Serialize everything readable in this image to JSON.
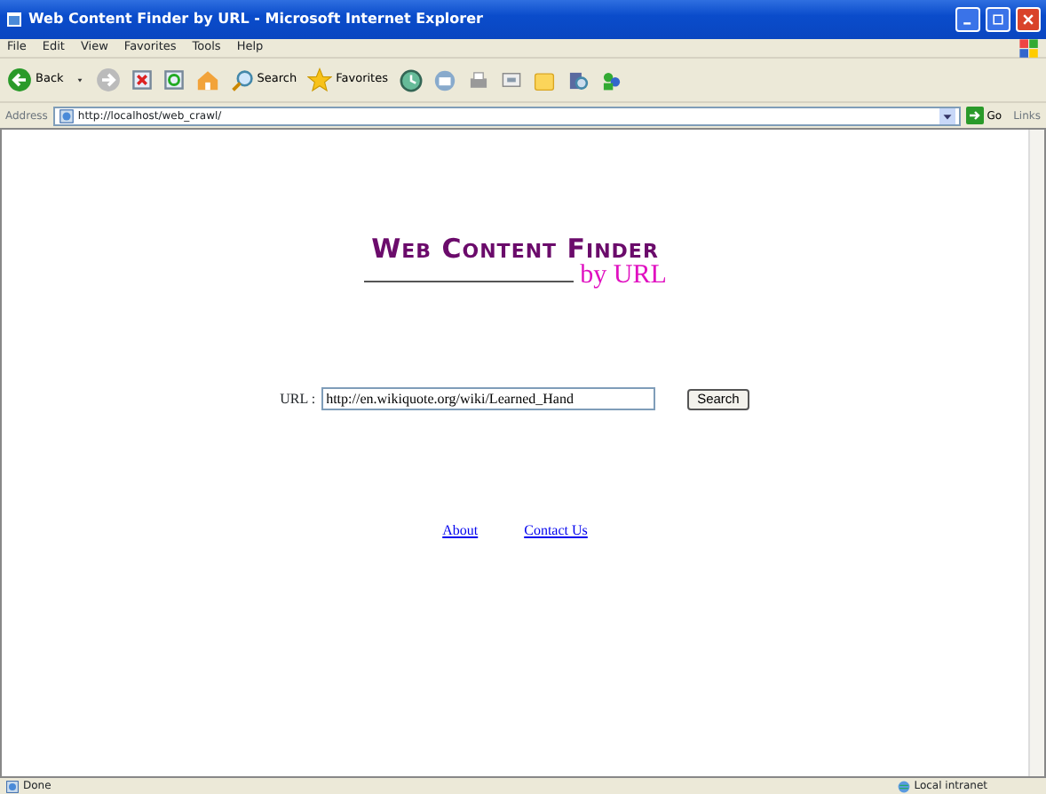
{
  "window": {
    "title": "Web Content Finder by URL - Microsoft Internet Explorer"
  },
  "menu": [
    "File",
    "Edit",
    "View",
    "Favorites",
    "Tools",
    "Help"
  ],
  "toolbar": {
    "back": "Back",
    "search": "Search",
    "favorites": "Favorites"
  },
  "address_bar": {
    "label": "Address",
    "value": "http://localhost/web_crawl/",
    "go": "Go",
    "links": "Links"
  },
  "page": {
    "heading": "Web Content Finder",
    "subheading": "by URL",
    "url_label": "URL :",
    "url_value": "http://en.wikiquote.org/wiki/Learned_Hand",
    "search_button": "Search",
    "links": [
      "About",
      "Contact Us"
    ]
  },
  "status_bar": {
    "text": "Done",
    "zone": "Local intranet"
  }
}
